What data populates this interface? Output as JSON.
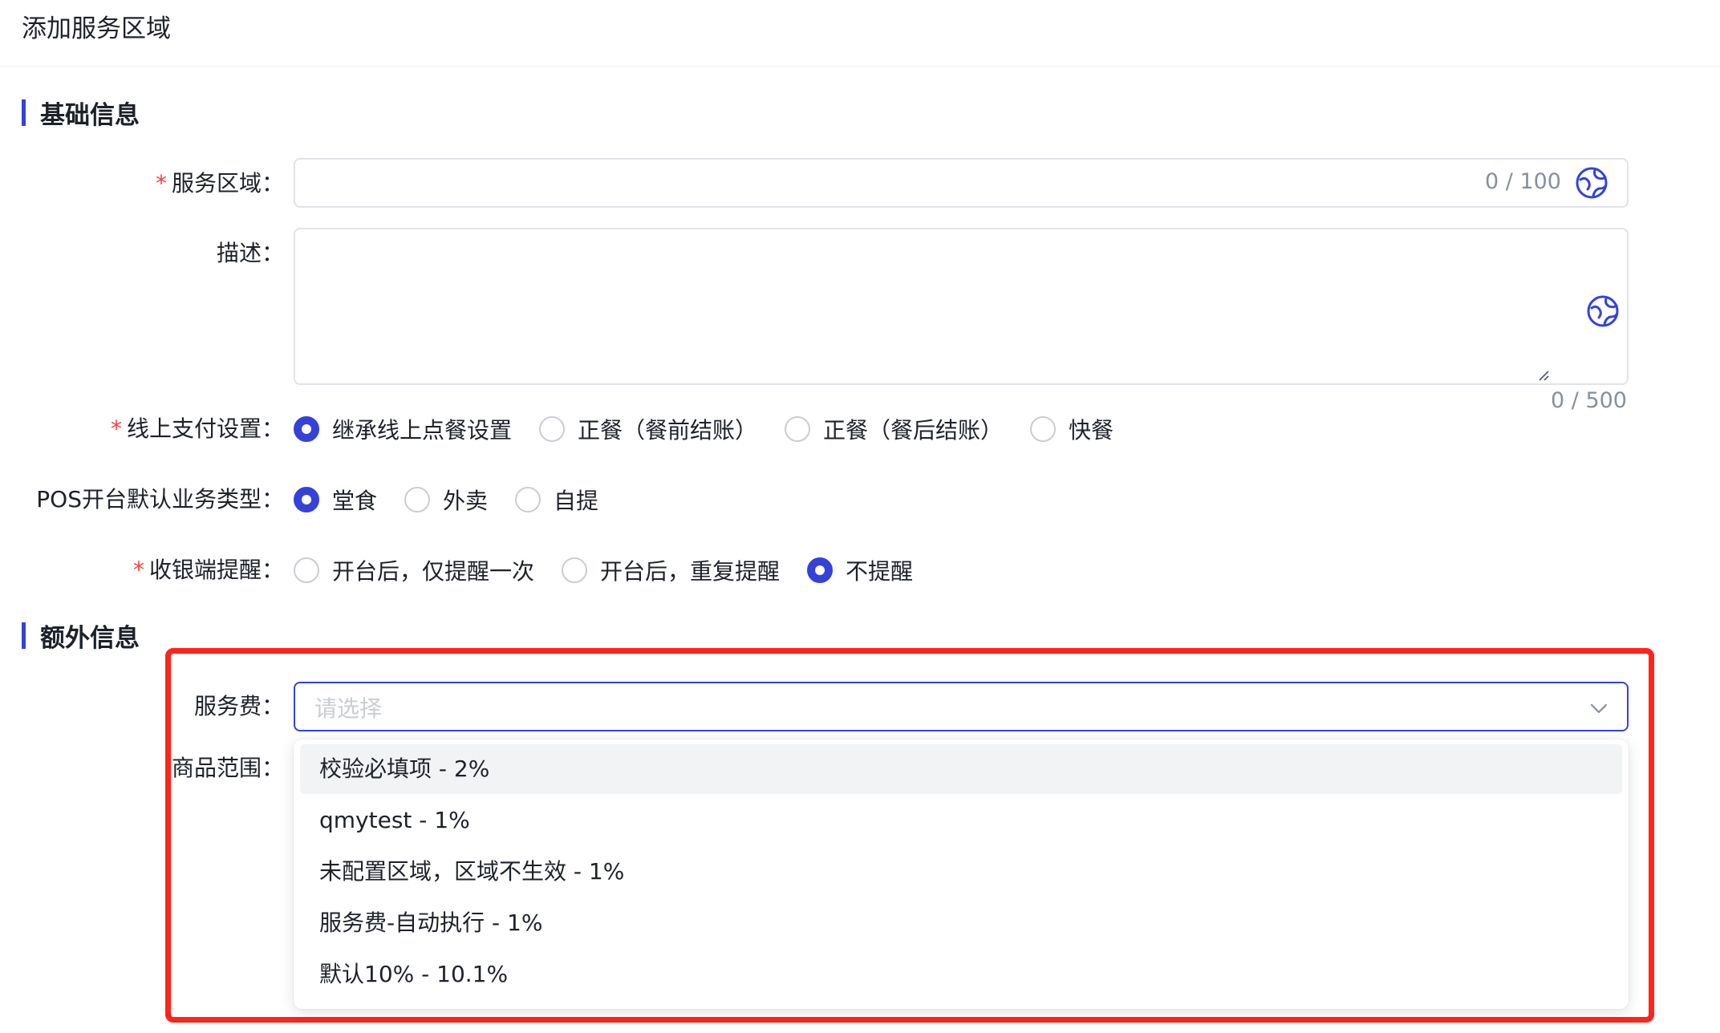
{
  "page": {
    "title": "添加服务区域"
  },
  "sections": {
    "basic": "基础信息",
    "extra": "额外信息"
  },
  "service_area": {
    "label": "服务区域：",
    "counter": "0 / 100",
    "value": ""
  },
  "description": {
    "label": "描述：",
    "counter": "0 / 500",
    "value": ""
  },
  "online_payment": {
    "label": "线上支付设置：",
    "options": [
      "继承线上点餐设置",
      "正餐（餐前结账）",
      "正餐（餐后结账）",
      "快餐"
    ],
    "selected": 0
  },
  "pos_default": {
    "label": "POS开台默认业务类型：",
    "options": [
      "堂食",
      "外卖",
      "自提"
    ],
    "selected": 0
  },
  "cashier_reminder": {
    "label": "收银端提醒：",
    "options": [
      "开台后，仅提醒一次",
      "开台后，重复提醒",
      "不提醒"
    ],
    "selected": 2
  },
  "service_fee": {
    "label": "服务费：",
    "placeholder": "请选择",
    "options": [
      "校验必填项 - 2%",
      "qmytest - 1%",
      "未配置区域，区域不生效 - 1%",
      "服务费-自动执行 - 1%",
      "默认10% - 10.1%"
    ],
    "hovered": 0
  },
  "product_scope": {
    "label": "商品范围："
  },
  "required_mark": "*",
  "colors": {
    "primary": "#3442d9",
    "required": "#f53f3f",
    "highlight": "#ff2419"
  },
  "icons": {
    "translate": "globe-icon",
    "dropdown": "chevron-down-icon"
  }
}
